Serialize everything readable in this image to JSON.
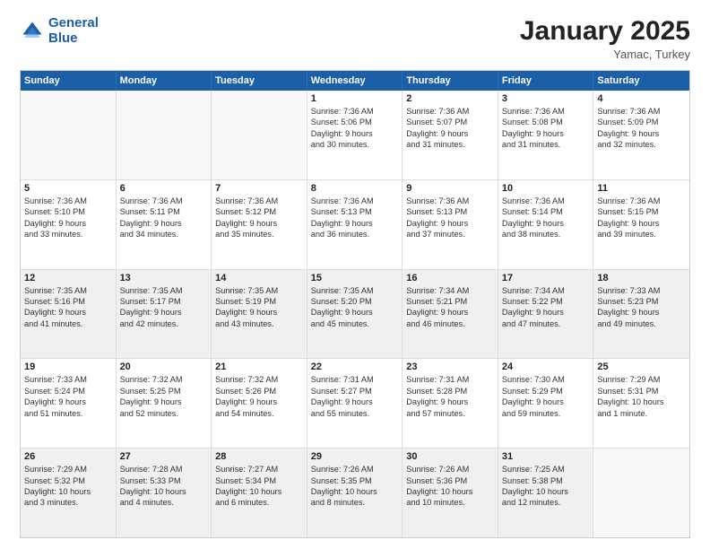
{
  "logo": {
    "line1": "General",
    "line2": "Blue"
  },
  "title": "January 2025",
  "location": "Yamac, Turkey",
  "header_days": [
    "Sunday",
    "Monday",
    "Tuesday",
    "Wednesday",
    "Thursday",
    "Friday",
    "Saturday"
  ],
  "weeks": [
    [
      {
        "day": "",
        "lines": [],
        "empty": true
      },
      {
        "day": "",
        "lines": [],
        "empty": true
      },
      {
        "day": "",
        "lines": [],
        "empty": true
      },
      {
        "day": "1",
        "lines": [
          "Sunrise: 7:36 AM",
          "Sunset: 5:06 PM",
          "Daylight: 9 hours",
          "and 30 minutes."
        ],
        "empty": false
      },
      {
        "day": "2",
        "lines": [
          "Sunrise: 7:36 AM",
          "Sunset: 5:07 PM",
          "Daylight: 9 hours",
          "and 31 minutes."
        ],
        "empty": false
      },
      {
        "day": "3",
        "lines": [
          "Sunrise: 7:36 AM",
          "Sunset: 5:08 PM",
          "Daylight: 9 hours",
          "and 31 minutes."
        ],
        "empty": false
      },
      {
        "day": "4",
        "lines": [
          "Sunrise: 7:36 AM",
          "Sunset: 5:09 PM",
          "Daylight: 9 hours",
          "and 32 minutes."
        ],
        "empty": false
      }
    ],
    [
      {
        "day": "5",
        "lines": [
          "Sunrise: 7:36 AM",
          "Sunset: 5:10 PM",
          "Daylight: 9 hours",
          "and 33 minutes."
        ],
        "empty": false
      },
      {
        "day": "6",
        "lines": [
          "Sunrise: 7:36 AM",
          "Sunset: 5:11 PM",
          "Daylight: 9 hours",
          "and 34 minutes."
        ],
        "empty": false
      },
      {
        "day": "7",
        "lines": [
          "Sunrise: 7:36 AM",
          "Sunset: 5:12 PM",
          "Daylight: 9 hours",
          "and 35 minutes."
        ],
        "empty": false
      },
      {
        "day": "8",
        "lines": [
          "Sunrise: 7:36 AM",
          "Sunset: 5:13 PM",
          "Daylight: 9 hours",
          "and 36 minutes."
        ],
        "empty": false
      },
      {
        "day": "9",
        "lines": [
          "Sunrise: 7:36 AM",
          "Sunset: 5:13 PM",
          "Daylight: 9 hours",
          "and 37 minutes."
        ],
        "empty": false
      },
      {
        "day": "10",
        "lines": [
          "Sunrise: 7:36 AM",
          "Sunset: 5:14 PM",
          "Daylight: 9 hours",
          "and 38 minutes."
        ],
        "empty": false
      },
      {
        "day": "11",
        "lines": [
          "Sunrise: 7:36 AM",
          "Sunset: 5:15 PM",
          "Daylight: 9 hours",
          "and 39 minutes."
        ],
        "empty": false
      }
    ],
    [
      {
        "day": "12",
        "lines": [
          "Sunrise: 7:35 AM",
          "Sunset: 5:16 PM",
          "Daylight: 9 hours",
          "and 41 minutes."
        ],
        "empty": false,
        "shaded": true
      },
      {
        "day": "13",
        "lines": [
          "Sunrise: 7:35 AM",
          "Sunset: 5:17 PM",
          "Daylight: 9 hours",
          "and 42 minutes."
        ],
        "empty": false,
        "shaded": true
      },
      {
        "day": "14",
        "lines": [
          "Sunrise: 7:35 AM",
          "Sunset: 5:19 PM",
          "Daylight: 9 hours",
          "and 43 minutes."
        ],
        "empty": false,
        "shaded": true
      },
      {
        "day": "15",
        "lines": [
          "Sunrise: 7:35 AM",
          "Sunset: 5:20 PM",
          "Daylight: 9 hours",
          "and 45 minutes."
        ],
        "empty": false,
        "shaded": true
      },
      {
        "day": "16",
        "lines": [
          "Sunrise: 7:34 AM",
          "Sunset: 5:21 PM",
          "Daylight: 9 hours",
          "and 46 minutes."
        ],
        "empty": false,
        "shaded": true
      },
      {
        "day": "17",
        "lines": [
          "Sunrise: 7:34 AM",
          "Sunset: 5:22 PM",
          "Daylight: 9 hours",
          "and 47 minutes."
        ],
        "empty": false,
        "shaded": true
      },
      {
        "day": "18",
        "lines": [
          "Sunrise: 7:33 AM",
          "Sunset: 5:23 PM",
          "Daylight: 9 hours",
          "and 49 minutes."
        ],
        "empty": false,
        "shaded": true
      }
    ],
    [
      {
        "day": "19",
        "lines": [
          "Sunrise: 7:33 AM",
          "Sunset: 5:24 PM",
          "Daylight: 9 hours",
          "and 51 minutes."
        ],
        "empty": false
      },
      {
        "day": "20",
        "lines": [
          "Sunrise: 7:32 AM",
          "Sunset: 5:25 PM",
          "Daylight: 9 hours",
          "and 52 minutes."
        ],
        "empty": false
      },
      {
        "day": "21",
        "lines": [
          "Sunrise: 7:32 AM",
          "Sunset: 5:26 PM",
          "Daylight: 9 hours",
          "and 54 minutes."
        ],
        "empty": false
      },
      {
        "day": "22",
        "lines": [
          "Sunrise: 7:31 AM",
          "Sunset: 5:27 PM",
          "Daylight: 9 hours",
          "and 55 minutes."
        ],
        "empty": false
      },
      {
        "day": "23",
        "lines": [
          "Sunrise: 7:31 AM",
          "Sunset: 5:28 PM",
          "Daylight: 9 hours",
          "and 57 minutes."
        ],
        "empty": false
      },
      {
        "day": "24",
        "lines": [
          "Sunrise: 7:30 AM",
          "Sunset: 5:29 PM",
          "Daylight: 9 hours",
          "and 59 minutes."
        ],
        "empty": false
      },
      {
        "day": "25",
        "lines": [
          "Sunrise: 7:29 AM",
          "Sunset: 5:31 PM",
          "Daylight: 10 hours",
          "and 1 minute."
        ],
        "empty": false
      }
    ],
    [
      {
        "day": "26",
        "lines": [
          "Sunrise: 7:29 AM",
          "Sunset: 5:32 PM",
          "Daylight: 10 hours",
          "and 3 minutes."
        ],
        "empty": false,
        "shaded": true
      },
      {
        "day": "27",
        "lines": [
          "Sunrise: 7:28 AM",
          "Sunset: 5:33 PM",
          "Daylight: 10 hours",
          "and 4 minutes."
        ],
        "empty": false,
        "shaded": true
      },
      {
        "day": "28",
        "lines": [
          "Sunrise: 7:27 AM",
          "Sunset: 5:34 PM",
          "Daylight: 10 hours",
          "and 6 minutes."
        ],
        "empty": false,
        "shaded": true
      },
      {
        "day": "29",
        "lines": [
          "Sunrise: 7:26 AM",
          "Sunset: 5:35 PM",
          "Daylight: 10 hours",
          "and 8 minutes."
        ],
        "empty": false,
        "shaded": true
      },
      {
        "day": "30",
        "lines": [
          "Sunrise: 7:26 AM",
          "Sunset: 5:36 PM",
          "Daylight: 10 hours",
          "and 10 minutes."
        ],
        "empty": false,
        "shaded": true
      },
      {
        "day": "31",
        "lines": [
          "Sunrise: 7:25 AM",
          "Sunset: 5:38 PM",
          "Daylight: 10 hours",
          "and 12 minutes."
        ],
        "empty": false,
        "shaded": true
      },
      {
        "day": "",
        "lines": [],
        "empty": true,
        "shaded": true
      }
    ]
  ]
}
